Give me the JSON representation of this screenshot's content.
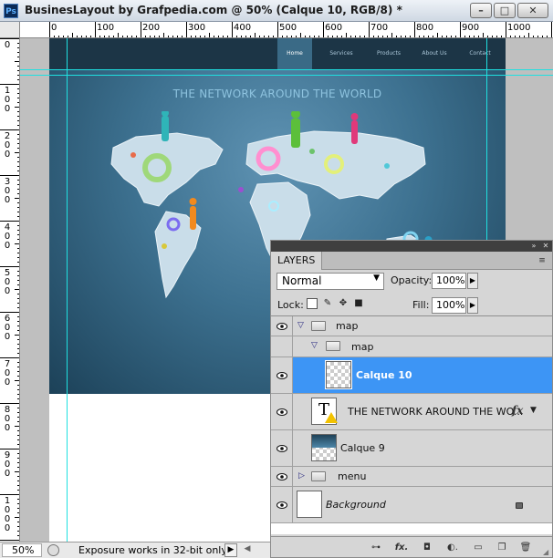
{
  "window": {
    "title": "BusinesLayout by Grafpedia.com @ 50% (Calque 10, RGB/8) *",
    "app_badge": "Ps",
    "controls": {
      "minimize": "–",
      "maximize": "□",
      "close": "✕"
    }
  },
  "rulers": {
    "horizontal_labels": [
      "0",
      "100",
      "200",
      "300",
      "400",
      "500",
      "600",
      "700",
      "800",
      "900",
      "1000"
    ],
    "vertical_labels": [
      "0",
      "100",
      "200",
      "300",
      "400",
      "500",
      "600",
      "700",
      "800",
      "900",
      "1000"
    ]
  },
  "document": {
    "nav": [
      "Home",
      "Services",
      "Products",
      "About Us",
      "Contact"
    ],
    "active_nav": "Home",
    "headline": "THE NETWORK AROUND THE WORLD"
  },
  "status": {
    "zoom": "50%",
    "message": "Exposure works in 32-bit only",
    "arrow": "▶",
    "scroll_left": "◀"
  },
  "layers_panel": {
    "tab": "LAYERS",
    "menu_icon": "≡",
    "blend_mode": "Normal",
    "opacity_label": "Opacity:",
    "opacity_value": "100%",
    "lock_label": "Lock:",
    "fill_label": "Fill:",
    "fill_value": "100%",
    "layers": [
      {
        "name": "map",
        "type": "group",
        "expanded": true,
        "indent": 0
      },
      {
        "name": "map",
        "type": "group",
        "expanded": true,
        "indent": 1
      },
      {
        "name": "Calque 10",
        "type": "pixel",
        "selected": true
      },
      {
        "name": "THE NETWORK AROUND THE WO...",
        "type": "text",
        "fx": "fx"
      },
      {
        "name": "Calque 9",
        "type": "pixel"
      },
      {
        "name": "menu",
        "type": "group",
        "expanded": false,
        "indent": 0
      },
      {
        "name": "Background",
        "type": "background",
        "locked": true
      }
    ],
    "footer_icons": [
      "link-layers-icon",
      "add-style-icon",
      "add-mask-icon",
      "adjustment-layer-icon",
      "new-group-icon",
      "new-layer-icon",
      "delete-layer-icon"
    ],
    "footer_glyphs": [
      "⊶",
      "fx.",
      "◘",
      "◐.",
      "▭",
      "❐",
      "🗑"
    ]
  },
  "colors": {
    "selection": "#3d95f5",
    "guides": "#1fe0e0",
    "panel_bg": "#d6d6d6"
  }
}
